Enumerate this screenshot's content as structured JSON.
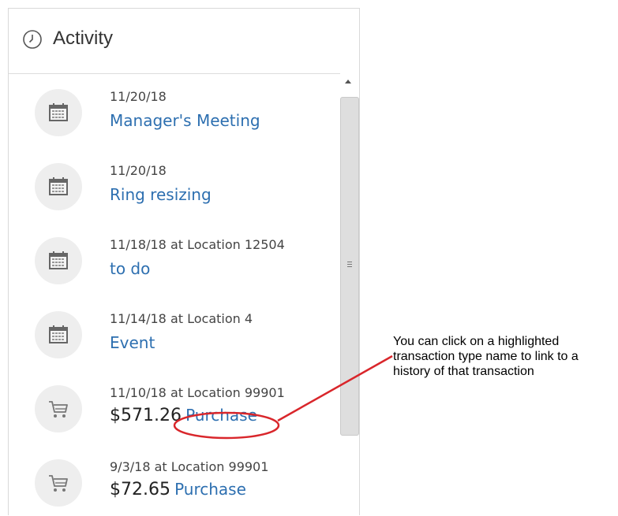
{
  "panel": {
    "title": "Activity",
    "header_icon": "clock-icon"
  },
  "activities": [
    {
      "icon": "calendar-icon",
      "meta": "11/20/18",
      "name": "Manager's Meeting"
    },
    {
      "icon": "calendar-icon",
      "meta": "11/20/18",
      "name": "Ring resizing"
    },
    {
      "icon": "calendar-icon",
      "meta": "11/18/18 at Location 12504",
      "name": "to do"
    },
    {
      "icon": "calendar-icon",
      "meta": "11/14/18 at Location 4",
      "name": "Event"
    },
    {
      "icon": "cart-icon",
      "meta": "11/10/18 at Location 99901",
      "amount": "$571.26",
      "type": "Purchase"
    },
    {
      "icon": "cart-icon",
      "meta": "9/3/18 at Location 99901",
      "amount": "$72.65",
      "type": "Purchase"
    }
  ],
  "annotation": {
    "text": "You can click on a highlighted transaction type name to link to a history of that transaction",
    "color": "#d9262b"
  },
  "colors": {
    "link": "#2d6fb0",
    "icon_bg": "#eeeeee"
  }
}
